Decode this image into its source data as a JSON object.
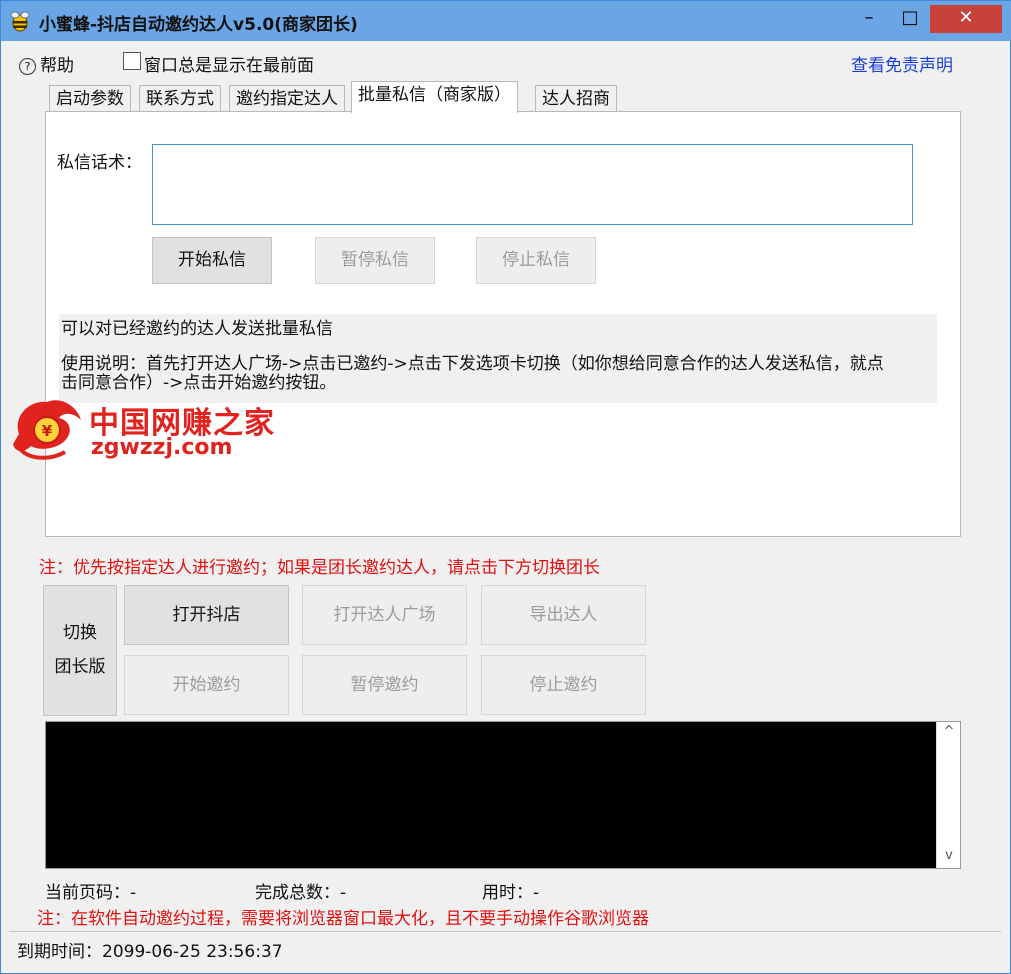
{
  "window": {
    "title": "小蜜蜂-抖店自动邀约达人v5.0(商家团长)",
    "minimize_label": "–",
    "maximize_label": "□",
    "close_label": "✕"
  },
  "menu": {
    "help_icon": "?",
    "help_label": "帮助",
    "on_top_label": "窗口总是显示在最前面",
    "disclaimer_link": "查看免责声明"
  },
  "tabs": [
    "启动参数",
    "联系方式",
    "邀约指定达人",
    "批量私信（商家版）",
    "达人招商"
  ],
  "dm_panel": {
    "script_label": "私信话术：",
    "script_value": "",
    "start_button": "开始私信",
    "pause_button": "暂停私信",
    "stop_button": "停止私信",
    "info_line1": "可以对已经邀约的达人发送批量私信",
    "info_line2": "使用说明：首先打开达人广场->点击已邀约->点击下发选项卡切换（如你想给同意合作的达人发送私信，就点",
    "info_line3": "击同意合作）->点击开始邀约按钮。"
  },
  "watermark": {
    "cn_text": "中国网赚之家",
    "url_text": "zgwzzj.com",
    "coin_glyph": "¥"
  },
  "notice_top": "注：优先按指定达人进行邀约；如果是团长邀约达人，请点击下方切换团长",
  "controls": {
    "switch_line1": "切换",
    "switch_line2": "团长版",
    "open_store": "打开抖店",
    "open_plaza": "打开达人广场",
    "export": "导出达人",
    "start_invite": "开始邀约",
    "pause_invite": "暂停邀约",
    "stop_invite": "停止邀约"
  },
  "console": {
    "scroll_up": "^",
    "scroll_down": "v"
  },
  "stats": {
    "page_label": "当前页码：-",
    "total_label": "完成总数：-",
    "time_label": "用时：-"
  },
  "notice_bottom": "注：在软件自动邀约过程，需要将浏览器窗口最大化，且不要手动操作谷歌浏览器",
  "status": {
    "expiry": "到期时间：2099-06-25 23:56:37"
  },
  "colors": {
    "title_bar": "#6aa6e5",
    "close_button": "#c7423a",
    "link": "#1a3fd6",
    "warning_text": "#e01010",
    "watermark": "#e0231e",
    "console_bg": "#000000"
  }
}
